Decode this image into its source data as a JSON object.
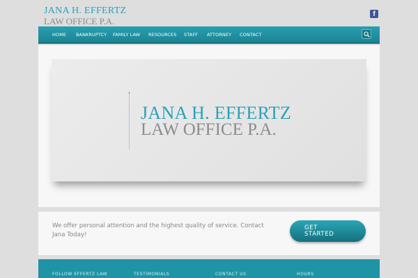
{
  "header": {
    "logo_line1": "JANA H. EFFERTZ",
    "logo_line2": "LAW OFFICE P.A.",
    "social_icon": "facebook-icon"
  },
  "nav": {
    "items": [
      {
        "label": "HOME"
      },
      {
        "label": "BANKRUPTCY"
      },
      {
        "label": "FAMILY LAW"
      },
      {
        "label": "RESOURCES"
      },
      {
        "label": "STAFF"
      },
      {
        "label": "ATTORNEY"
      },
      {
        "label": "CONTACT"
      }
    ],
    "search_icon": "search-icon"
  },
  "hero": {
    "line1": "JANA H. EFFERTZ",
    "line2": "LAW OFFICE P.A."
  },
  "callout": {
    "text": "We offer personal attention and the highest quality of service. Contact Jana Today!",
    "button_line1": "GET",
    "button_line2": "STARTED"
  },
  "footer": {
    "headings": [
      "FOLLOW EFFERTZ LAW",
      "TESTIMONIALS",
      "CONTACT US",
      "HOURS"
    ]
  },
  "colors": {
    "accent": "#2aa1b8",
    "nav_bg": "#1f91a2",
    "footer_bg": "#1e94a6",
    "page_bg": "#dedede",
    "facebook": "#3b5998"
  }
}
